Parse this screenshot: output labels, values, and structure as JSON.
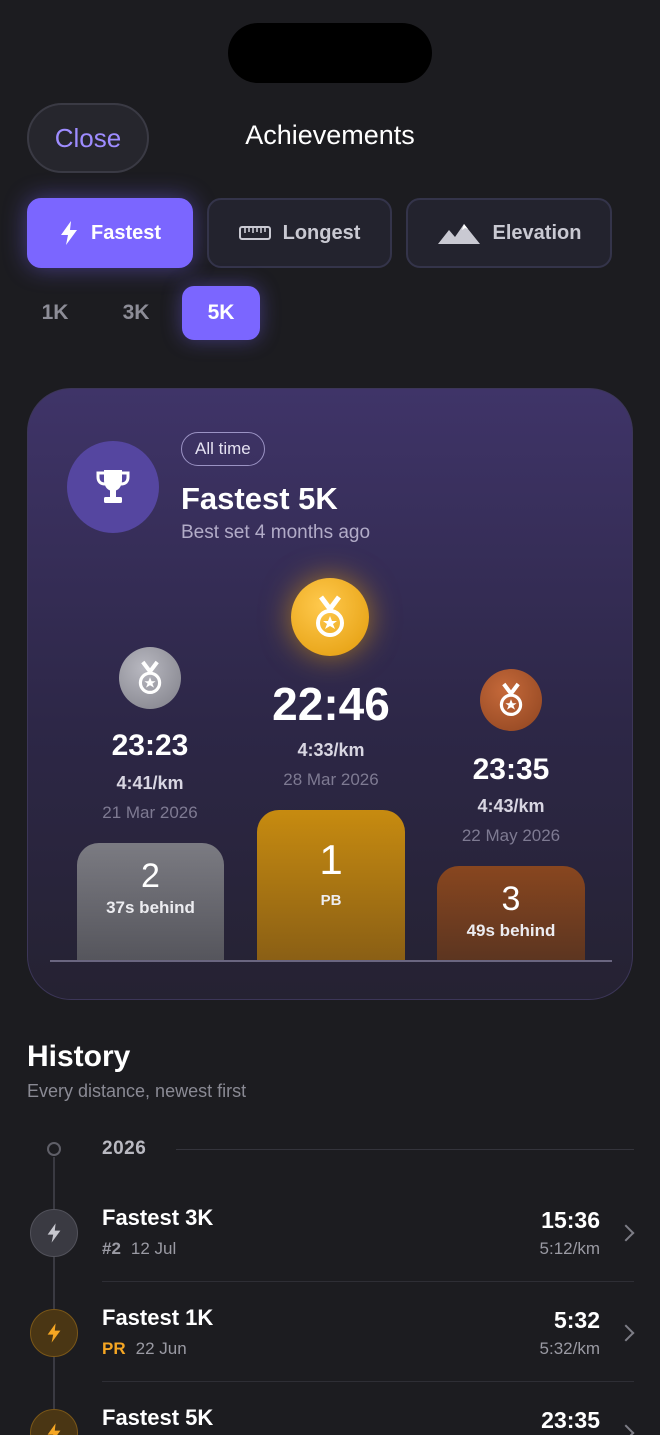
{
  "header": {
    "close_label": "Close",
    "title": "Achievements"
  },
  "tabs": [
    {
      "label": "Fastest",
      "icon": "lightning-icon",
      "active": true
    },
    {
      "label": "Longest",
      "icon": "ruler-icon",
      "active": false
    },
    {
      "label": "Elevation",
      "icon": "mountain-icon",
      "active": false
    }
  ],
  "distances": [
    {
      "label": "1K",
      "active": false
    },
    {
      "label": "3K",
      "active": false
    },
    {
      "label": "5K",
      "active": true
    }
  ],
  "card": {
    "badge": "All time",
    "title": "Fastest 5K",
    "subtitle": "Best set 4 months ago",
    "podium": {
      "first": {
        "time": "22:46",
        "pace": "4:33/km",
        "date": "28 Mar 2026",
        "rank": "1",
        "note": "PB",
        "medal_color": "#f2a91b"
      },
      "second": {
        "time": "23:23",
        "pace": "4:41/km",
        "date": "21 Mar 2026",
        "rank": "2",
        "note": "37s behind",
        "medal_color": "#9b9ba3"
      },
      "third": {
        "time": "23:35",
        "pace": "4:43/km",
        "date": "22 May 2026",
        "rank": "3",
        "note": "49s behind",
        "medal_color": "#b0562a"
      }
    }
  },
  "history": {
    "title": "History",
    "subtitle": "Every distance, newest first",
    "year": "2026",
    "items": [
      {
        "title": "Fastest 3K",
        "tag": "#2",
        "tag_type": "rank",
        "date": "12 Jul",
        "time": "15:36",
        "pace": "5:12/km",
        "icon": "lightning-icon",
        "color": "gray"
      },
      {
        "title": "Fastest 1K",
        "tag": "PR",
        "tag_type": "pr",
        "date": "22 Jun",
        "time": "5:32",
        "pace": "5:32/km",
        "icon": "lightning-icon",
        "color": "orange"
      },
      {
        "title": "Fastest 5K",
        "tag": "",
        "tag_type": "",
        "date": "",
        "time": "23:35",
        "pace": "",
        "icon": "lightning-icon",
        "color": "orange"
      }
    ]
  },
  "colors": {
    "accent": "#7b66ff",
    "gold": "#f2a91b",
    "bronze": "#b0562a",
    "silver": "#9b9ba3",
    "background": "#1c1c20"
  }
}
